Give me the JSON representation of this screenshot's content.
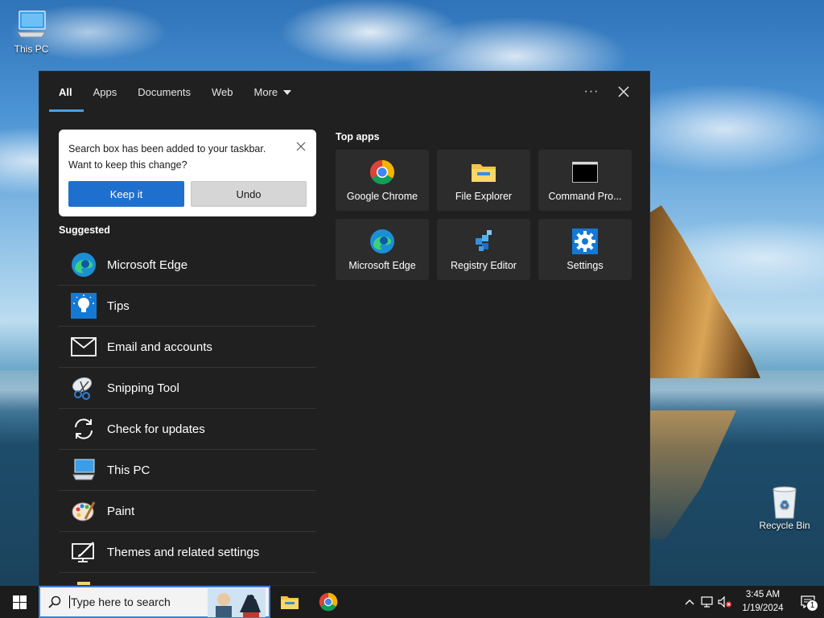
{
  "desktop": {
    "icons": [
      {
        "label": "This PC"
      },
      {
        "label": "Recycle Bin"
      }
    ]
  },
  "search_panel": {
    "tabs": [
      {
        "label": "All",
        "active": true
      },
      {
        "label": "Apps"
      },
      {
        "label": "Documents"
      },
      {
        "label": "Web"
      },
      {
        "label": "More"
      }
    ],
    "more_options_label": "···",
    "toast": {
      "message": "Search box has been added to your taskbar. Want to keep this change?",
      "keep_label": "Keep it",
      "undo_label": "Undo"
    },
    "suggested_title": "Suggested",
    "suggested": [
      {
        "label": "Microsoft Edge",
        "icon": "edge-icon"
      },
      {
        "label": "Tips",
        "icon": "tips-icon"
      },
      {
        "label": "Email and accounts",
        "icon": "mail-icon"
      },
      {
        "label": "Snipping Tool",
        "icon": "snipping-tool-icon"
      },
      {
        "label": "Check for updates",
        "icon": "refresh-icon"
      },
      {
        "label": "This PC",
        "icon": "computer-icon"
      },
      {
        "label": "Paint",
        "icon": "paint-icon"
      },
      {
        "label": "Themes and related settings",
        "icon": "themes-icon"
      }
    ],
    "top_apps_title": "Top apps",
    "top_apps": [
      {
        "label": "Google Chrome",
        "icon": "chrome-icon"
      },
      {
        "label": "File Explorer",
        "icon": "folder-icon"
      },
      {
        "label": "Command Pro...",
        "icon": "cmd-icon"
      },
      {
        "label": "Microsoft Edge",
        "icon": "edge-icon"
      },
      {
        "label": "Registry Editor",
        "icon": "registry-icon"
      },
      {
        "label": "Settings",
        "icon": "gear-icon"
      }
    ]
  },
  "taskbar": {
    "search_placeholder": "Type here to search",
    "clock_time": "3:45 AM",
    "clock_date": "1/19/2024",
    "notification_count": "1"
  },
  "colors": {
    "accent": "#1f6fcf",
    "panel_bg": "#202020",
    "tile_bg": "#2c2c2c",
    "tab_underline": "#4aa0e6"
  }
}
